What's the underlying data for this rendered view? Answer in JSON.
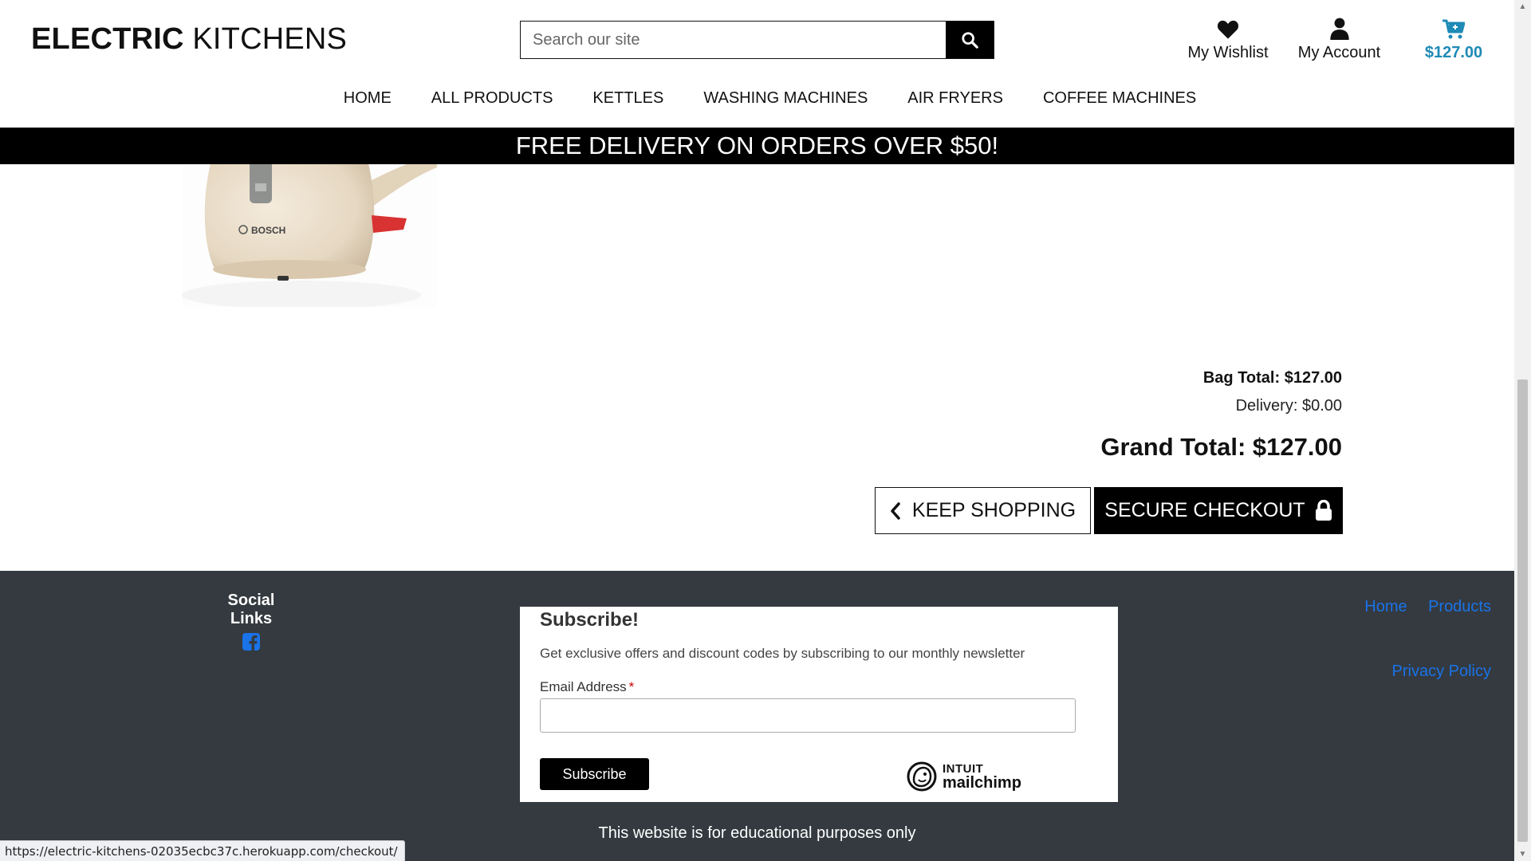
{
  "header": {
    "brand_bold": "ELECTRIC",
    "brand_rest": " KITCHENS",
    "search_placeholder": "Search our site",
    "wishlist_label": "My Wishlist",
    "account_label": "My Account",
    "bag_total": "$127.00"
  },
  "nav": {
    "items": [
      "HOME",
      "ALL PRODUCTS",
      "KETTLES",
      "WASHING MACHINES",
      "AIR FRYERS",
      "COFFEE MACHINES"
    ]
  },
  "promo": "FREE DELIVERY ON ORDERS OVER $50!",
  "product": {
    "image_brand_text": "BOSCH"
  },
  "totals": {
    "bag_total": "Bag Total: $127.00",
    "delivery": "Delivery: $0.00",
    "grand_total": "Grand Total: $127.00"
  },
  "buttons": {
    "keep_shopping": "KEEP SHOPPING",
    "secure_checkout": "SECURE CHECKOUT"
  },
  "footer": {
    "social_title": "Social Links",
    "links": [
      "Home",
      "Products"
    ],
    "privacy": "Privacy Policy",
    "subscribe": {
      "title": "Subscribe!",
      "description": "Get exclusive offers and discount codes by subscribing to our monthly newsletter",
      "email_label": "Email Address",
      "required_mark": "*",
      "button": "Subscribe",
      "brand_intuit": "INTUIT",
      "brand_mailchimp": "mailchimp"
    },
    "disclaimer": "This website is for educational purposes only"
  },
  "status_url": "https://electric-kitchens-02035ecbc37c.herokuapp.com/checkout/",
  "colors": {
    "accent_blue": "#1e8ab5",
    "link_blue": "#1a73e8",
    "footer_bg": "#343a40",
    "promo_bg": "#000000"
  },
  "icons": [
    "search-icon",
    "heart-icon",
    "user-icon",
    "cart-icon",
    "chevron-left-icon",
    "lock-icon",
    "facebook-icon",
    "mailchimp-logo-icon"
  ]
}
